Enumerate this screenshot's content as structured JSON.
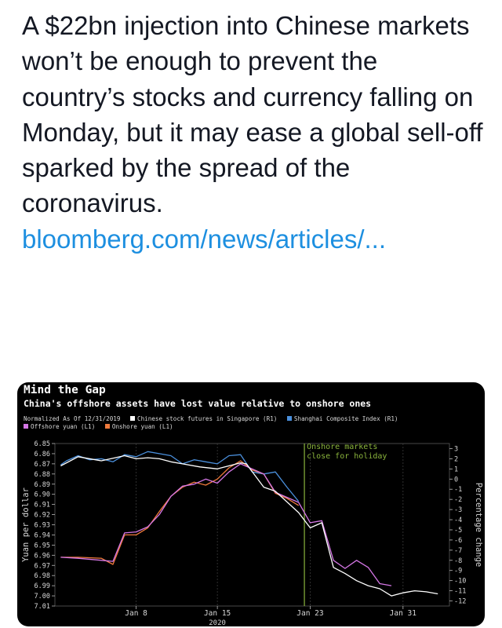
{
  "tweet": {
    "text": "A $22bn injection into Chinese markets won’t be enough to prevent the country’s stocks and currency falling on Monday, but it may ease a global sell-off sparked by the spread of the coronavirus.",
    "link": "bloomberg.com/news/articles/..."
  },
  "colors": {
    "background": "#000000",
    "futures": "#ffffff",
    "shanghai": "#4a8fdc",
    "offshore_yuan": "#d577e6",
    "onshore_yuan": "#ef7a3c",
    "holiday_line": "#8ab43c"
  },
  "chart_data": {
    "type": "line",
    "title": "Mind the Gap",
    "subtitle": "China's offshore assets have lost value relative to onshore ones",
    "normalized_note": "Normalized As Of 12/31/2019",
    "annotation": "Onshore markets close for holiday",
    "annotation_x": "Jan 23",
    "legend": [
      {
        "label": "Chinese stock futures in Singapore (R1)",
        "color": "#ffffff"
      },
      {
        "label": "Shanghai Composite Index (R1)",
        "color": "#4a8fdc"
      },
      {
        "label": "Offshore yuan (L1)",
        "color": "#d577e6"
      },
      {
        "label": "Onshore yuan (L1)",
        "color": "#ef7a3c"
      }
    ],
    "left_axis": {
      "label": "Yuan per dollar",
      "inverted": true,
      "range": [
        6.85,
        7.01
      ],
      "ticks": [
        "6.85",
        "6.86",
        "6.87",
        "6.88",
        "6.89",
        "6.90",
        "6.91",
        "6.92",
        "6.93",
        "6.94",
        "6.95",
        "6.96",
        "6.97",
        "6.98",
        "6.99",
        "7.00",
        "7.01"
      ]
    },
    "right_axis": {
      "label": "Percentage change",
      "range": [
        -12.5,
        3.5
      ],
      "ticks": [
        "3",
        "2",
        "1",
        "0",
        "-1",
        "-2",
        "-3",
        "-4",
        "-5",
        "-6",
        "-7",
        "-8",
        "-9",
        "-10",
        "-11",
        "-12"
      ]
    },
    "x_axis": {
      "ticks": [
        "Jan 8",
        "Jan 15",
        "Jan 23",
        "Jan 31"
      ],
      "year_label": "2020",
      "tick_days": [
        8,
        15,
        23,
        31
      ]
    },
    "series": [
      {
        "name": "Chinese stock futures in Singapore (R1)",
        "axis": "right",
        "color": "#ffffff",
        "x": [
          1.5,
          3,
          5,
          7,
          8,
          9,
          10,
          11,
          12,
          13.5,
          15,
          17,
          17.5,
          19,
          20,
          22,
          23,
          24,
          25,
          26,
          27,
          28,
          29,
          30,
          31,
          32,
          33,
          34
        ],
        "y": [
          1.3,
          2.2,
          1.8,
          2.3,
          2.0,
          2.1,
          2.0,
          1.7,
          1.5,
          1.2,
          1.0,
          1.6,
          1.5,
          -0.8,
          -1.2,
          -3.3,
          -4.8,
          -4.3,
          -8.7,
          -9.3,
          -10.0,
          -10.5,
          -10.8,
          -11.5,
          -11.2,
          -11.0,
          -11.1,
          -11.3
        ]
      },
      {
        "name": "Shanghai Composite Index (R1)",
        "axis": "right",
        "color": "#4a8fdc",
        "x": [
          1.5,
          2,
          3,
          4,
          5,
          6,
          7,
          8,
          9,
          10,
          11,
          12,
          13,
          14,
          15,
          16,
          17,
          18,
          19,
          20,
          21,
          22
        ],
        "y": [
          1.4,
          1.8,
          2.3,
          1.9,
          2.0,
          1.7,
          2.4,
          2.2,
          2.7,
          2.5,
          2.3,
          1.5,
          1.9,
          1.7,
          1.5,
          2.3,
          2.4,
          0.7,
          0.5,
          0.7,
          -0.8,
          -2.2
        ]
      },
      {
        "name": "Offshore yuan (L1)",
        "axis": "left",
        "color": "#d577e6",
        "x": [
          1.5,
          3,
          5,
          6,
          7,
          8,
          9,
          10,
          11,
          12,
          13,
          14,
          15,
          16,
          17,
          18,
          19,
          20,
          21,
          22,
          23,
          24,
          25,
          26,
          27,
          28,
          29,
          30
        ],
        "y": [
          6.962,
          6.963,
          6.965,
          6.966,
          6.938,
          6.937,
          6.932,
          6.92,
          6.902,
          6.892,
          6.89,
          6.885,
          6.889,
          6.878,
          6.87,
          6.875,
          6.88,
          6.898,
          6.903,
          6.908,
          6.928,
          6.926,
          6.965,
          6.973,
          6.965,
          6.972,
          6.988,
          6.99
        ]
      },
      {
        "name": "Onshore yuan (L1)",
        "axis": "left",
        "color": "#ef7a3c",
        "x": [
          1.5,
          3,
          5,
          6,
          7,
          8,
          9,
          10,
          11,
          12,
          13,
          14,
          15,
          16,
          17,
          18,
          19,
          20,
          21,
          22
        ],
        "y": [
          6.962,
          6.962,
          6.963,
          6.969,
          6.94,
          6.94,
          6.933,
          6.917,
          6.902,
          6.893,
          6.888,
          6.891,
          6.885,
          6.874,
          6.867,
          6.876,
          6.88,
          6.899,
          6.904,
          6.911
        ]
      }
    ]
  }
}
